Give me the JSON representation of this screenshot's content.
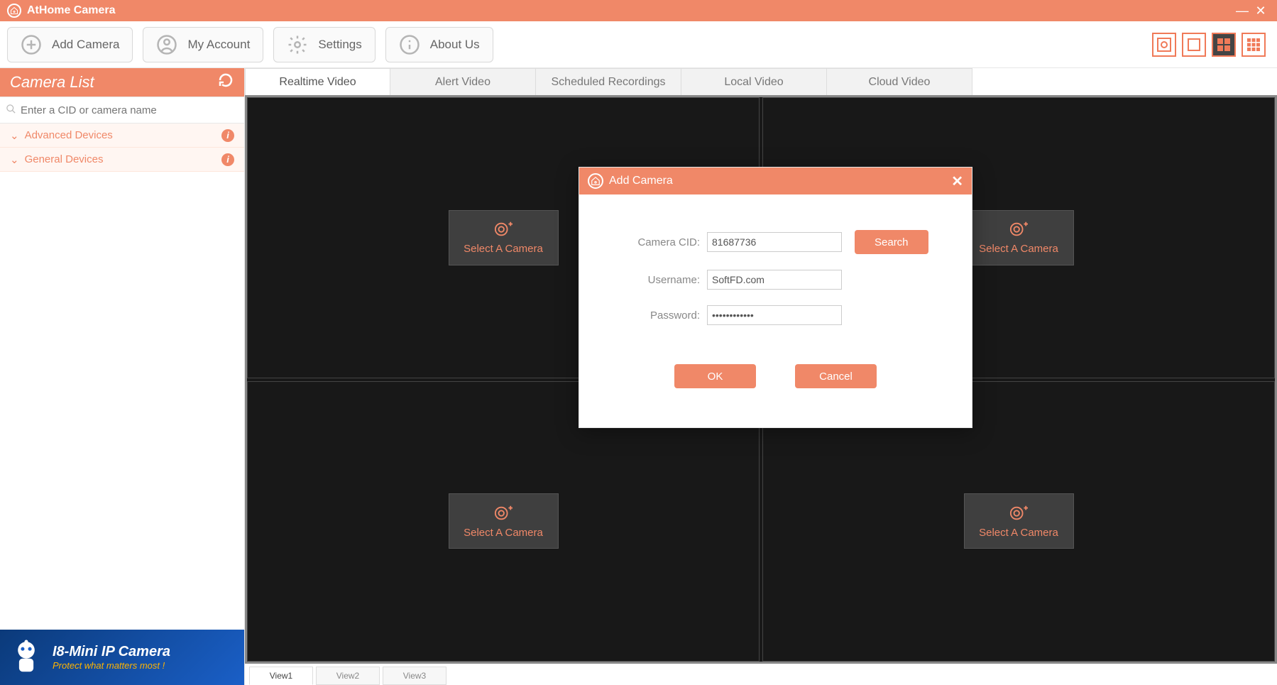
{
  "app": {
    "title": "AtHome Camera"
  },
  "toolbar": {
    "add_camera": "Add Camera",
    "my_account": "My Account",
    "settings": "Settings",
    "about_us": "About Us"
  },
  "sidebar": {
    "title": "Camera List",
    "search_placeholder": "Enter a CID or camera name",
    "groups": [
      {
        "label": "Advanced Devices"
      },
      {
        "label": "General Devices"
      }
    ],
    "banner_title": "I8-Mini IP Camera",
    "banner_sub": "Protect what matters most !"
  },
  "tabs": [
    "Realtime Video",
    "Alert Video",
    "Scheduled Recordings",
    "Local Video",
    "Cloud Video"
  ],
  "cell_label": "Select A Camera",
  "views": [
    "View1",
    "View2",
    "View3"
  ],
  "dialog": {
    "title": "Add Camera",
    "cid_label": "Camera CID:",
    "cid_value": "81687736",
    "search_btn": "Search",
    "user_label": "Username:",
    "user_value": "SoftFD.com",
    "pass_label": "Password:",
    "pass_value": "••••••••••••",
    "ok": "OK",
    "cancel": "Cancel"
  }
}
